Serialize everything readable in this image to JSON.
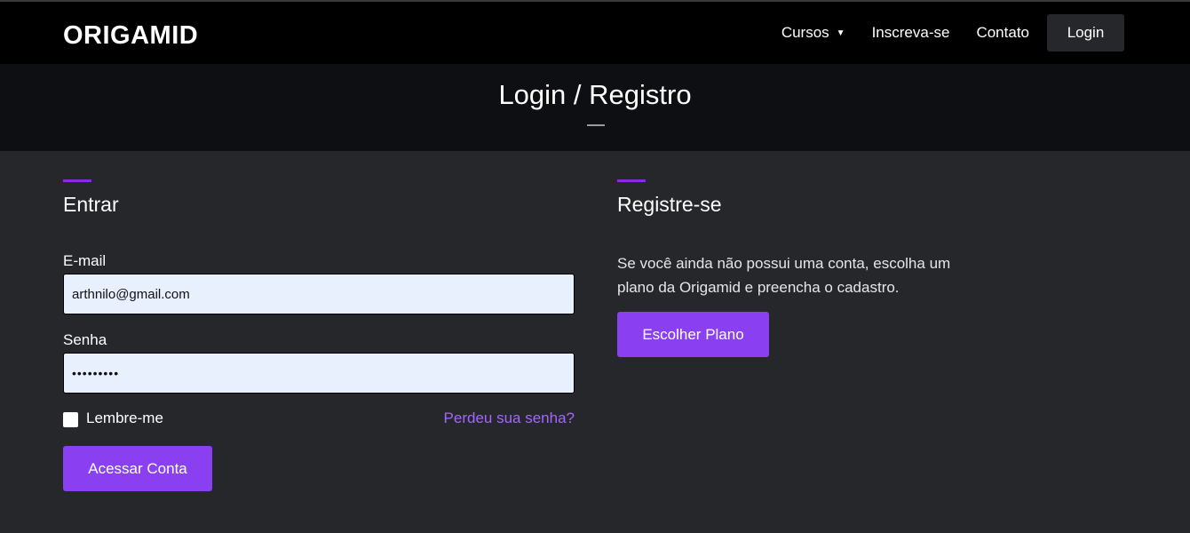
{
  "header": {
    "logo_text": "ORIGAMID",
    "nav": {
      "cursos": "Cursos",
      "inscreva": "Inscreva-se",
      "contato": "Contato",
      "login": "Login"
    }
  },
  "hero": {
    "title": "Login / Registro"
  },
  "login_section": {
    "title": "Entrar",
    "email_label": "E-mail",
    "email_value": "arthnilo@gmail.com",
    "password_label": "Senha",
    "password_value": "•••••••••",
    "remember_label": "Lembre-me",
    "forgot_link": "Perdeu sua senha?",
    "submit_label": "Acessar Conta"
  },
  "register_section": {
    "title": "Registre-se",
    "text": "Se você ainda não possui uma conta, escolha um plano da Origamid e preencha o cadastro.",
    "button_label": "Escolher Plano"
  },
  "colors": {
    "accent": "#8a3ff0",
    "link": "#a366ff",
    "background": "#26272b",
    "topbar": "#000000",
    "hero": "#0e0f12"
  },
  "icons": {
    "cursos_caret": "caret-down-icon"
  }
}
